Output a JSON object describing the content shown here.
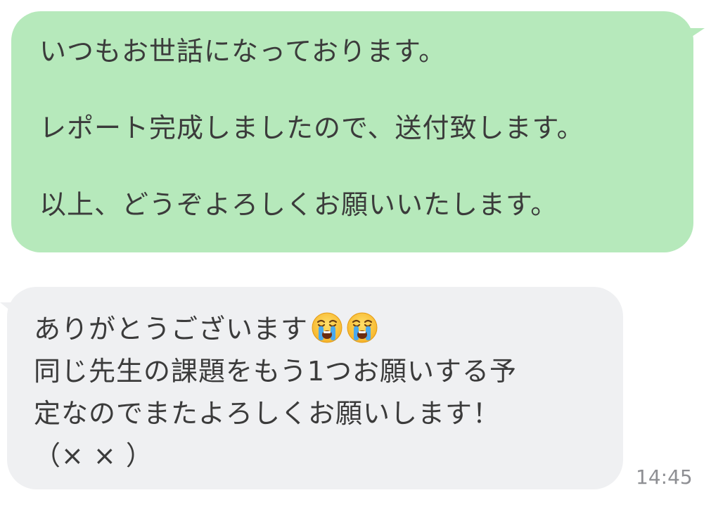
{
  "outgoing_message": {
    "lines": [
      "いつもお世話になっております。",
      "レポート完成しましたので、送付致します。",
      "以上、どうぞよろしくお願いいたします。"
    ]
  },
  "incoming_message": {
    "lines": [
      "ありがとうございます",
      "同じ先生の課題をもう1つお願いする予",
      "定なのでまたよろしくお願いします！",
      "（× × ）"
    ],
    "emojis": [
      "loudly-crying-face-icon",
      "loudly-crying-face-icon"
    ]
  },
  "timestamp": "14:45",
  "colors": {
    "outgoing_bubble": "#b6e9bb",
    "incoming_bubble": "#eff0f2",
    "text": "#3b3b3b",
    "timestamp": "#8e8f93"
  }
}
